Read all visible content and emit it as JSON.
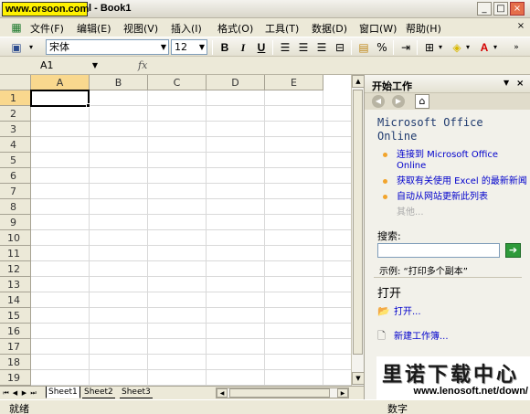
{
  "titlebar": {
    "watermark": "www.orsoon.com",
    "title": "l - Book1",
    "minimize": "_",
    "restore": "□",
    "close": "×"
  },
  "menu": {
    "items": [
      "文件(F)",
      "编辑(E)",
      "视图(V)",
      "插入(I)",
      "格式(O)",
      "工具(T)",
      "数据(D)",
      "窗口(W)",
      "帮助(H)"
    ],
    "close_doc": "×"
  },
  "toolbar": {
    "font_name": "宋体",
    "font_size": "12",
    "bold": "B",
    "italic": "I",
    "underline": "U",
    "percent": "%"
  },
  "formula_bar": {
    "cell_ref": "A1",
    "fx": "fx",
    "value": ""
  },
  "sheet": {
    "columns": [
      "A",
      "B",
      "C",
      "D",
      "E"
    ],
    "rows": [
      "1",
      "2",
      "3",
      "4",
      "5",
      "6",
      "7",
      "8",
      "9",
      "10",
      "11",
      "12",
      "13",
      "14",
      "15",
      "16",
      "17",
      "18",
      "19"
    ],
    "active_col": "A",
    "active_row": "1",
    "tabs": [
      "Sheet1",
      "Sheet2",
      "Sheet3"
    ],
    "active_tab": "Sheet1"
  },
  "status": {
    "left": "就绪",
    "right": "数字"
  },
  "taskpane": {
    "title": "开始工作",
    "office_online": "Microsoft Office Online",
    "links": [
      "连接到 Microsoft Office Online",
      "获取有关使用 Excel 的最新新闻",
      "自动从网站更新此列表"
    ],
    "more": "其他...",
    "search_label": "搜索:",
    "search_value": "",
    "example": "示例: “打印多个副本”",
    "open_title": "打开",
    "open_link": "打开...",
    "new_workbook": "新建工作簿..."
  },
  "brand": {
    "name": "里诺下载中心",
    "url": "www.lenosoft.net/down/"
  },
  "colors": {
    "active_header": "#f9d88e",
    "link": "#0000cc",
    "go_button": "#2e9a3a",
    "watermark_bg": "#fff200"
  }
}
